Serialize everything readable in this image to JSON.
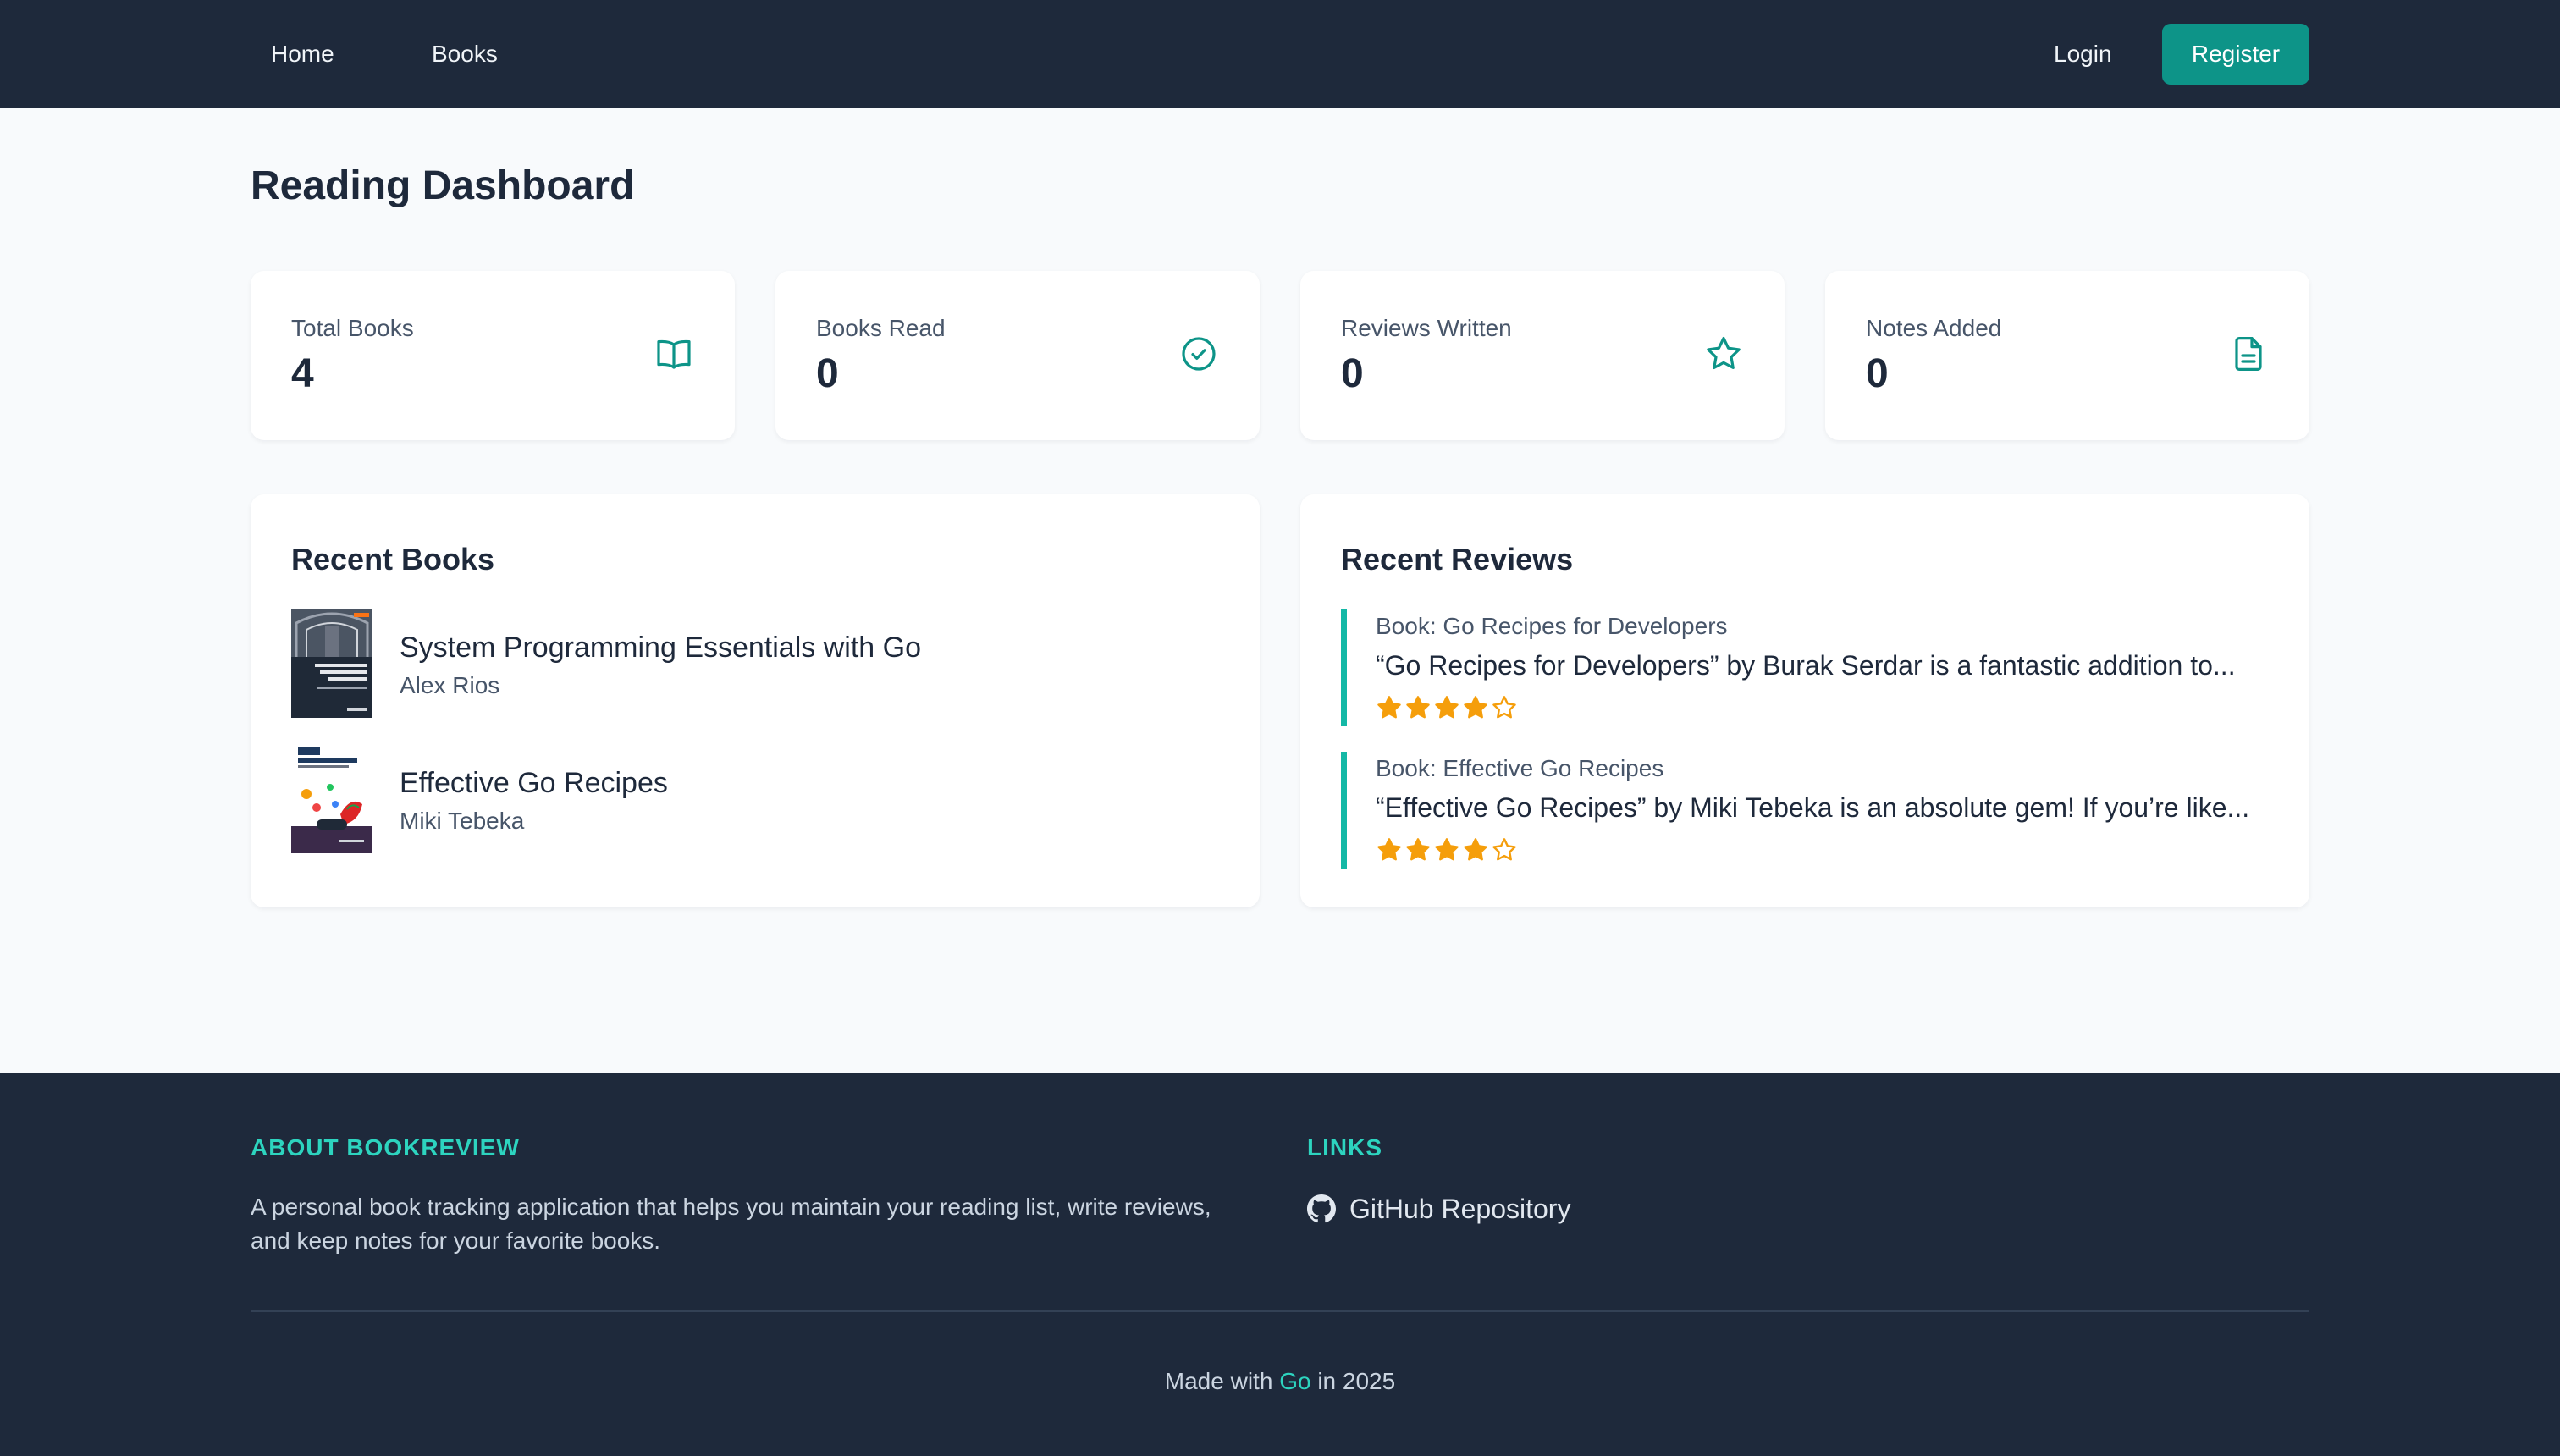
{
  "nav": {
    "home": "Home",
    "books": "Books",
    "login": "Login",
    "register": "Register"
  },
  "page_title": "Reading Dashboard",
  "stats": [
    {
      "label": "Total Books",
      "value": "4",
      "icon": "book-open-icon"
    },
    {
      "label": "Books Read",
      "value": "0",
      "icon": "check-circle-icon"
    },
    {
      "label": "Reviews Written",
      "value": "0",
      "icon": "star-icon"
    },
    {
      "label": "Notes Added",
      "value": "0",
      "icon": "document-icon"
    }
  ],
  "recent_books": {
    "title": "Recent Books",
    "items": [
      {
        "title": "System Programming Essentials with Go",
        "author": "Alex Rios"
      },
      {
        "title": "Effective Go Recipes",
        "author": "Miki Tebeka"
      }
    ]
  },
  "recent_reviews": {
    "title": "Recent Reviews",
    "items": [
      {
        "book": "Book: Go Recipes for Developers",
        "text": "“Go Recipes for Developers” by Burak Serdar is a fantastic addition to...",
        "rating": 4,
        "max_rating": 5
      },
      {
        "book": "Book: Effective Go Recipes",
        "text": "“Effective Go Recipes” by Miki Tebeka is an absolute gem! If you’re like...",
        "rating": 4,
        "max_rating": 5
      }
    ]
  },
  "footer": {
    "about_heading": "ABOUT BOOKREVIEW",
    "about_text": "A personal book tracking application that helps you maintain your reading list, write reviews, and keep notes for your favorite books.",
    "links_heading": "LINKS",
    "github_label": "GitHub Repository",
    "made_prefix": "Made with",
    "made_go": "Go",
    "made_suffix": "in 2025"
  },
  "colors": {
    "nav_bg": "#1e293b",
    "accent": "#0d9488",
    "accent_light": "#14b8a6",
    "footer_heading": "#2dd4bf",
    "star": "#f59e0b"
  }
}
